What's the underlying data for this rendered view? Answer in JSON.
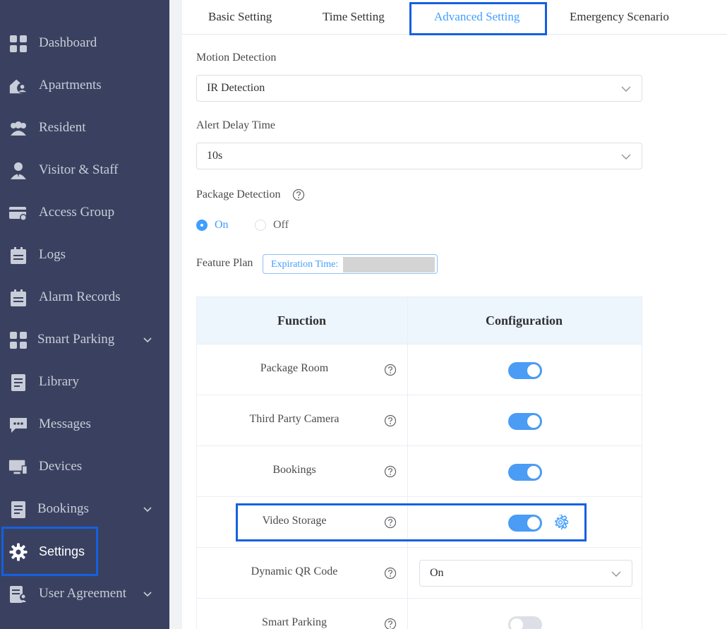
{
  "sidebar": {
    "items": [
      {
        "label": "Dashboard",
        "icon": "dashboard-icon"
      },
      {
        "label": "Apartments",
        "icon": "apartments-icon"
      },
      {
        "label": "Resident",
        "icon": "resident-icon"
      },
      {
        "label": "Visitor & Staff",
        "icon": "visitor-icon"
      },
      {
        "label": "Access Group",
        "icon": "access-group-icon"
      },
      {
        "label": "Logs",
        "icon": "logs-icon"
      },
      {
        "label": "Alarm Records",
        "icon": "alarm-records-icon"
      },
      {
        "label": "Smart Parking",
        "icon": "smart-parking-icon"
      },
      {
        "label": "Library",
        "icon": "library-icon"
      },
      {
        "label": "Messages",
        "icon": "messages-icon"
      },
      {
        "label": "Devices",
        "icon": "devices-icon"
      },
      {
        "label": "Bookings",
        "icon": "bookings-icon"
      },
      {
        "label": "Settings",
        "icon": "gear-icon"
      },
      {
        "label": "User Agreement",
        "icon": "user-agreement-icon"
      }
    ],
    "active": "Settings"
  },
  "tabs": [
    "Basic Setting",
    "Time Setting",
    "Advanced Setting",
    "Emergency Scenario"
  ],
  "active_tab": "Advanced Setting",
  "form": {
    "motion_detection_label": "Motion Detection",
    "motion_detection_value": "IR Detection",
    "alert_delay_label": "Alert Delay Time",
    "alert_delay_value": "10s",
    "package_detection_label": "Package Detection",
    "package_on": "On",
    "package_off": "Off",
    "package_selected": "On",
    "feature_plan_label": "Feature Plan",
    "expiration_label": "Expiration Time:"
  },
  "table": {
    "headers": {
      "function": "Function",
      "configuration": "Configuration"
    },
    "rows": [
      {
        "function": "Package Room",
        "type": "switch",
        "on": true
      },
      {
        "function": "Third Party Camera",
        "type": "switch",
        "on": true
      },
      {
        "function": "Bookings",
        "type": "switch",
        "on": true
      },
      {
        "function": "Video Storage",
        "type": "switch",
        "on": true,
        "settings_icon": "gear-icon"
      },
      {
        "function": "Dynamic QR Code",
        "type": "select",
        "value": "On"
      },
      {
        "function": "Smart Parking",
        "type": "switch",
        "on": false
      }
    ]
  },
  "colors": {
    "sidebar_bg": "#3a4160",
    "accent": "#409eff",
    "highlight_box": "#1560e0",
    "table_header_bg": "#edf5fd"
  }
}
